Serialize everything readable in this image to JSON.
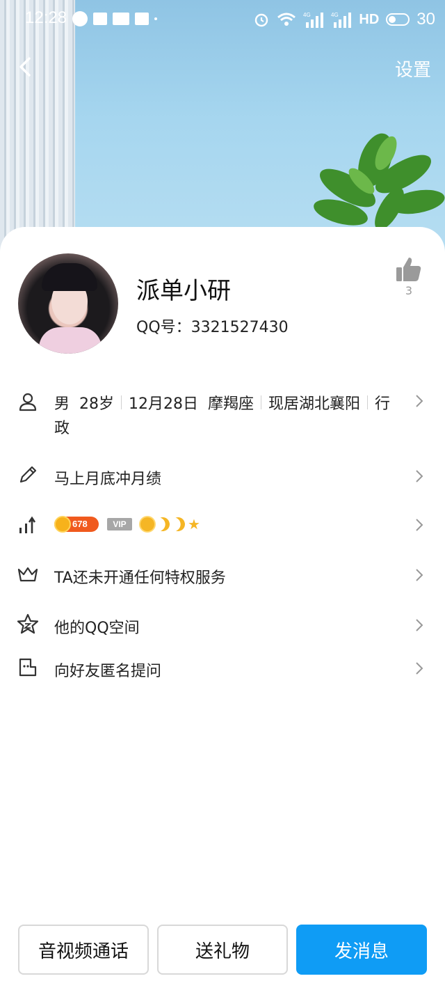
{
  "status_bar": {
    "time": "12:28",
    "network_1": "4G",
    "network_2": "4G",
    "hd_label": "HD",
    "battery": "30"
  },
  "nav": {
    "settings_label": "设置"
  },
  "profile": {
    "nickname": "派单小研",
    "qq_number": "QQ号：3321527430",
    "like_count": "3"
  },
  "rows": {
    "info": {
      "gender": "男",
      "age": "28岁",
      "birthday": "12月28日",
      "zodiac": "摩羯座",
      "location": "现居湖北襄阳",
      "job_first": "行",
      "job_rest": "政"
    },
    "signature": "马上月底冲月绩",
    "level": {
      "coin_count": "678",
      "vip_label": "VIP"
    },
    "privilege": "TA还未开通任何特权服务",
    "qzone": "他的QQ空间",
    "anonymous": "向好友匿名提问"
  },
  "actions": {
    "call": "音视频通话",
    "gift": "送礼物",
    "message": "发消息"
  },
  "colors": {
    "primary": "#0f9cf5",
    "coin_badge": "#f05a1e",
    "gold": "#f5b625"
  }
}
